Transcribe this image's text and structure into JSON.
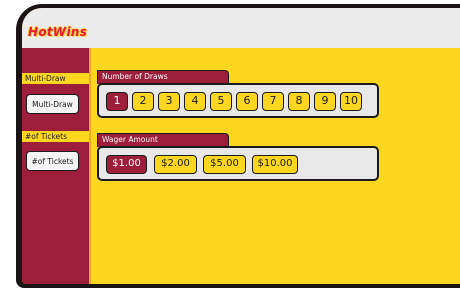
{
  "brand": {
    "logo_text": "HotWins"
  },
  "sidebar": {
    "multidraw_label": "Multi-Draw",
    "multidraw_button": "Multi-Draw",
    "tickets_label": "#of Tickets",
    "tickets_button": "#of Tickets"
  },
  "draws": {
    "title": "Number of Draws",
    "options": [
      "1",
      "2",
      "3",
      "4",
      "5",
      "6",
      "7",
      "8",
      "9",
      "10"
    ],
    "selected": "1"
  },
  "wager": {
    "title": "Wager Amount",
    "options": [
      "$1.00",
      "$2.00",
      "$5.00",
      "$10.00"
    ],
    "selected": "$1.00"
  },
  "colors": {
    "accent_red": "#9c1e3a",
    "background_yellow": "#fdd61f",
    "divider_orange": "#f5a623",
    "frame_dark": "#1a1416",
    "logo_red": "#e81a2c"
  }
}
